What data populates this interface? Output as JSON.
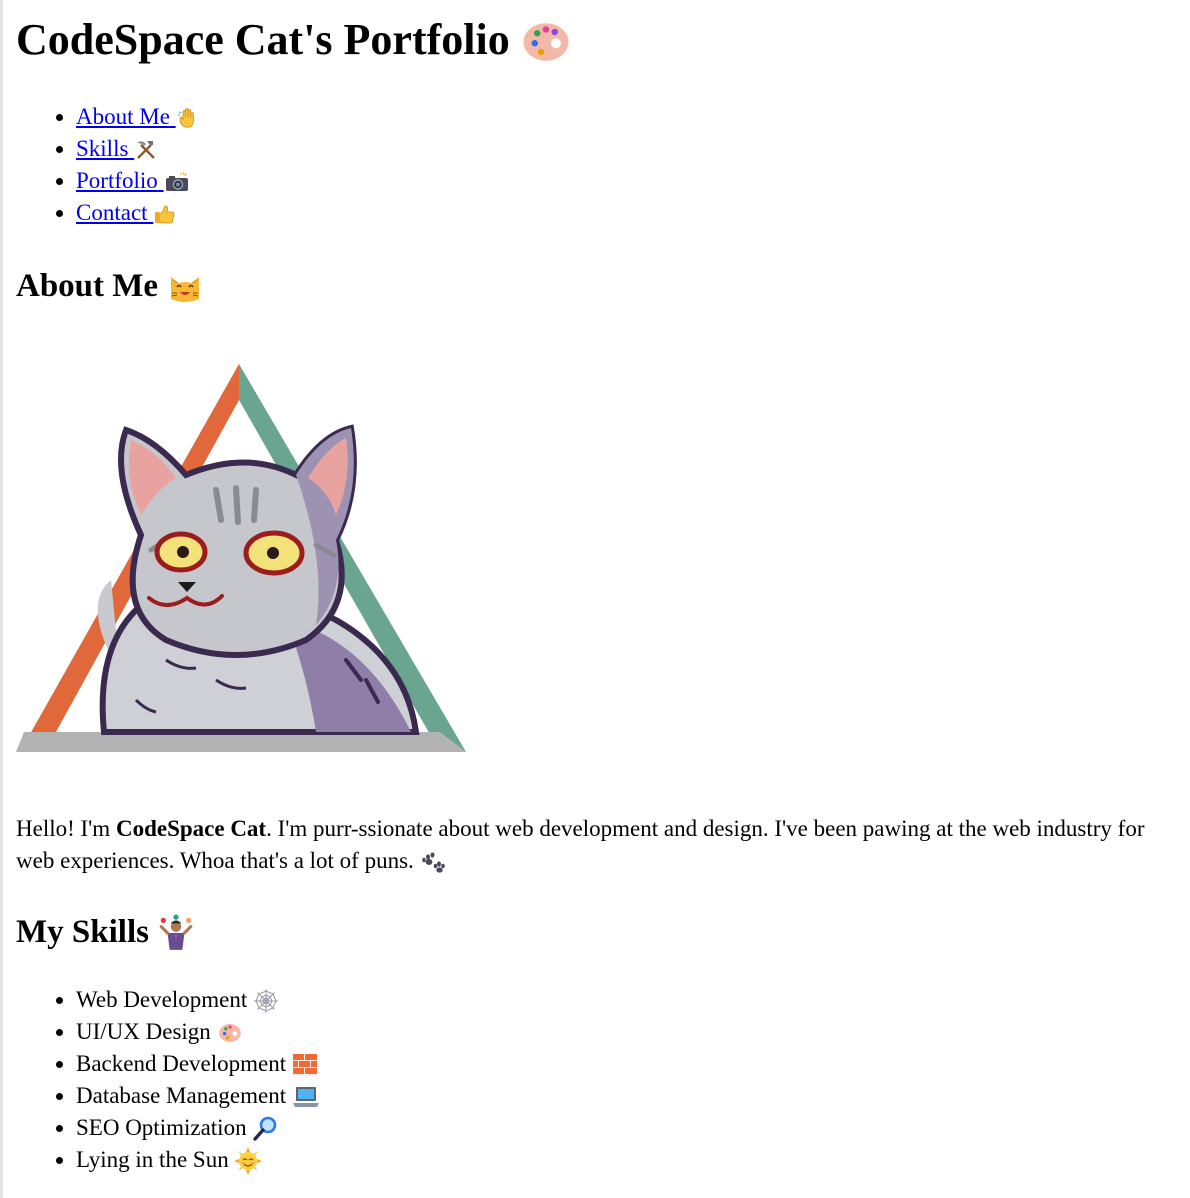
{
  "page": {
    "title": "CodeSpace Cat's Portfolio"
  },
  "nav": {
    "items": [
      {
        "label": "About Me",
        "icon": "waving-hand-icon"
      },
      {
        "label": "Skills",
        "icon": "hammer-pick-icon"
      },
      {
        "label": "Portfolio",
        "icon": "camera-flash-icon"
      },
      {
        "label": "Contact",
        "icon": "thumbs-up-icon"
      }
    ]
  },
  "about": {
    "heading": "About Me",
    "heading_icon": "smiling-cat-icon",
    "image_icon": "cat-portrait-illustration",
    "para_intro": "Hello! I'm ",
    "para_name": "CodeSpace Cat",
    "para_line1_rest": ". I'm purr-ssionate about web development and design. I've been pawing at the web industry for",
    "para_line2": "web experiences. Whoa that's a lot of puns.",
    "para_icon": "paw-prints-icon"
  },
  "skills": {
    "heading": "My Skills",
    "heading_icon": "juggler-icon",
    "items": [
      {
        "label": "Web Development",
        "icon": "spider-web-icon"
      },
      {
        "label": "UI/UX Design",
        "icon": "artist-palette-icon"
      },
      {
        "label": "Backend Development",
        "icon": "brick-icon"
      },
      {
        "label": "Database Management",
        "icon": "laptop-icon"
      },
      {
        "label": "SEO Optimization",
        "icon": "magnifying-glass-icon"
      },
      {
        "label": "Lying in the Sun",
        "icon": "sun-with-face-icon"
      }
    ]
  },
  "colors": {
    "link": "#0000ee",
    "triangle_orange": "#e0683a",
    "triangle_teal": "#6aa591",
    "triangle_base": "#b3b3b3"
  }
}
